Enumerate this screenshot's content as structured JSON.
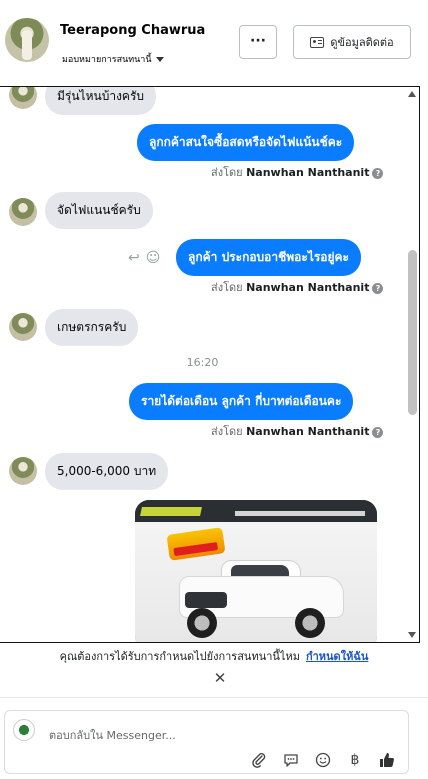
{
  "header": {
    "contact_name": "Teerapong Chawrua",
    "assign_label": "มอบหมายการสนทนานี้",
    "more_label": "···",
    "view_contact_label": "ดูข้อมูลติดต่อ"
  },
  "messages": [
    {
      "dir": "in",
      "text": "มีรุ่นไหนบ้างครับ"
    },
    {
      "dir": "out",
      "text": "ลูกกค้าสนใจซื้อสดหรือจัดไฟแน้นช์คะ"
    },
    {
      "dir": "in",
      "text": "จัดไฟแนนช์ครับ"
    },
    {
      "dir": "out",
      "text": "ลูกค้า ประกอบอาชีพอะไรอยู่คะ"
    },
    {
      "dir": "in",
      "text": "เกษตรกรครับ"
    },
    {
      "dir": "out",
      "text": "รายได้ต่อเดือน  ลูกค้า กี่บาทต่อเดือนคะ"
    },
    {
      "dir": "in",
      "text": "5,000-6,000 บาท"
    }
  ],
  "sent_by": {
    "prefix": "ส่งโดย",
    "name": "Nanwhan Nanthanit"
  },
  "time_separator": "16:20",
  "notice": {
    "text": "คุณต้องการได้รับการกำหนดไปยังการสนทนานี้ไหม",
    "link": "กำหนดให้ฉัน"
  },
  "composer": {
    "placeholder": "ตอบกลับใน Messenger...",
    "tool_icons": [
      "paperclip-icon",
      "saved-reply-icon",
      "emoji-icon",
      "baht-icon",
      "thumbs-up-icon"
    ]
  }
}
